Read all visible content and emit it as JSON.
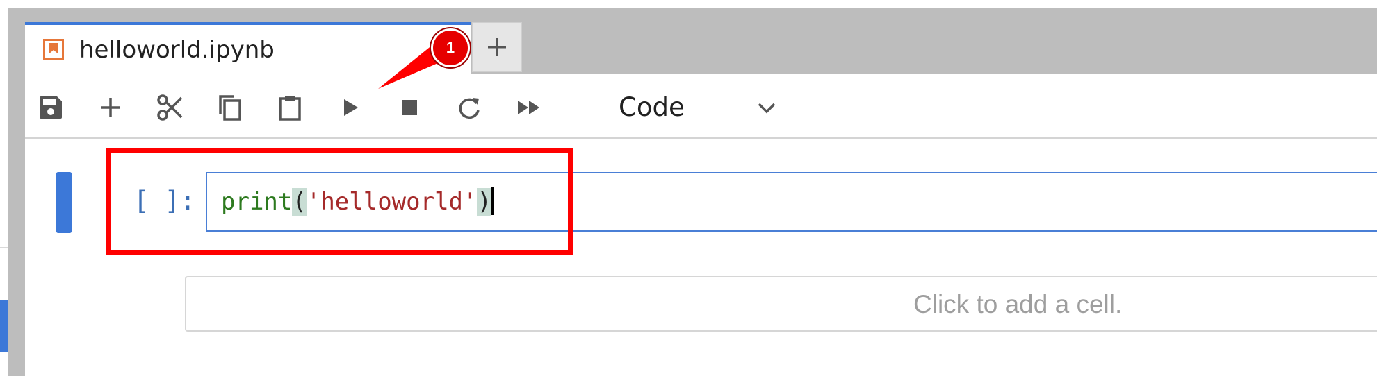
{
  "tab": {
    "title": "helloworld.ipynb",
    "icon": "notebook-icon"
  },
  "new_tab_icon": "plus-icon",
  "toolbar": {
    "buttons": [
      {
        "name": "save-button",
        "icon": "save-icon"
      },
      {
        "name": "insert-cell-button",
        "icon": "plus-icon"
      },
      {
        "name": "cut-button",
        "icon": "scissors-icon"
      },
      {
        "name": "copy-button",
        "icon": "copy-icon"
      },
      {
        "name": "paste-button",
        "icon": "clipboard-icon"
      },
      {
        "name": "run-button",
        "icon": "play-icon"
      },
      {
        "name": "interrupt-button",
        "icon": "stop-icon"
      },
      {
        "name": "restart-button",
        "icon": "refresh-icon"
      },
      {
        "name": "restart-run-all-button",
        "icon": "fast-forward-icon"
      }
    ],
    "cell_type": "Code"
  },
  "cell": {
    "prompt": "[ ]:",
    "code": {
      "func": "print",
      "open": "(",
      "string": "'helloworld'",
      "close": ")"
    }
  },
  "add_cell": {
    "label": "Click to add a cell."
  },
  "annotation": {
    "badge": "1"
  },
  "colors": {
    "accent": "#3c78d8",
    "highlight": "#ff0000",
    "keyword": "#2d7a1f",
    "string": "#a52a2a"
  }
}
